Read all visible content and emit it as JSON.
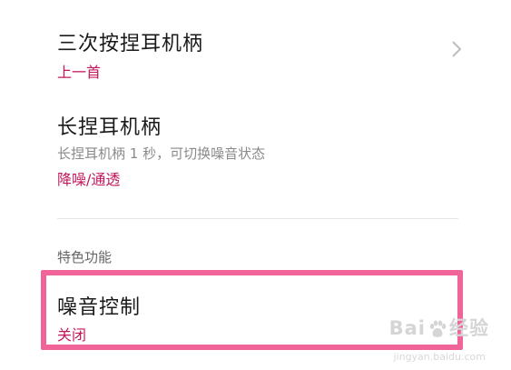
{
  "settings": {
    "triple_press": {
      "title": "三次按捏耳机柄",
      "value": "上一首"
    },
    "long_press": {
      "title": "长捏耳机柄",
      "description": "长捏耳机柄 1 秒，可切换噪音状态",
      "value": "降噪/通透"
    }
  },
  "section": {
    "header": "特色功能",
    "noise_control": {
      "title": "噪音控制",
      "value": "关闭"
    }
  },
  "watermark": {
    "brand_left": "Bai",
    "brand_right": "经验",
    "url": "jingyan.baidu.com"
  },
  "colors": {
    "accent": "#c2185b",
    "highlight": "#f0649a"
  },
  "icons": {
    "chevron": "chevron-right-icon",
    "paw": "baidu-paw-icon"
  }
}
